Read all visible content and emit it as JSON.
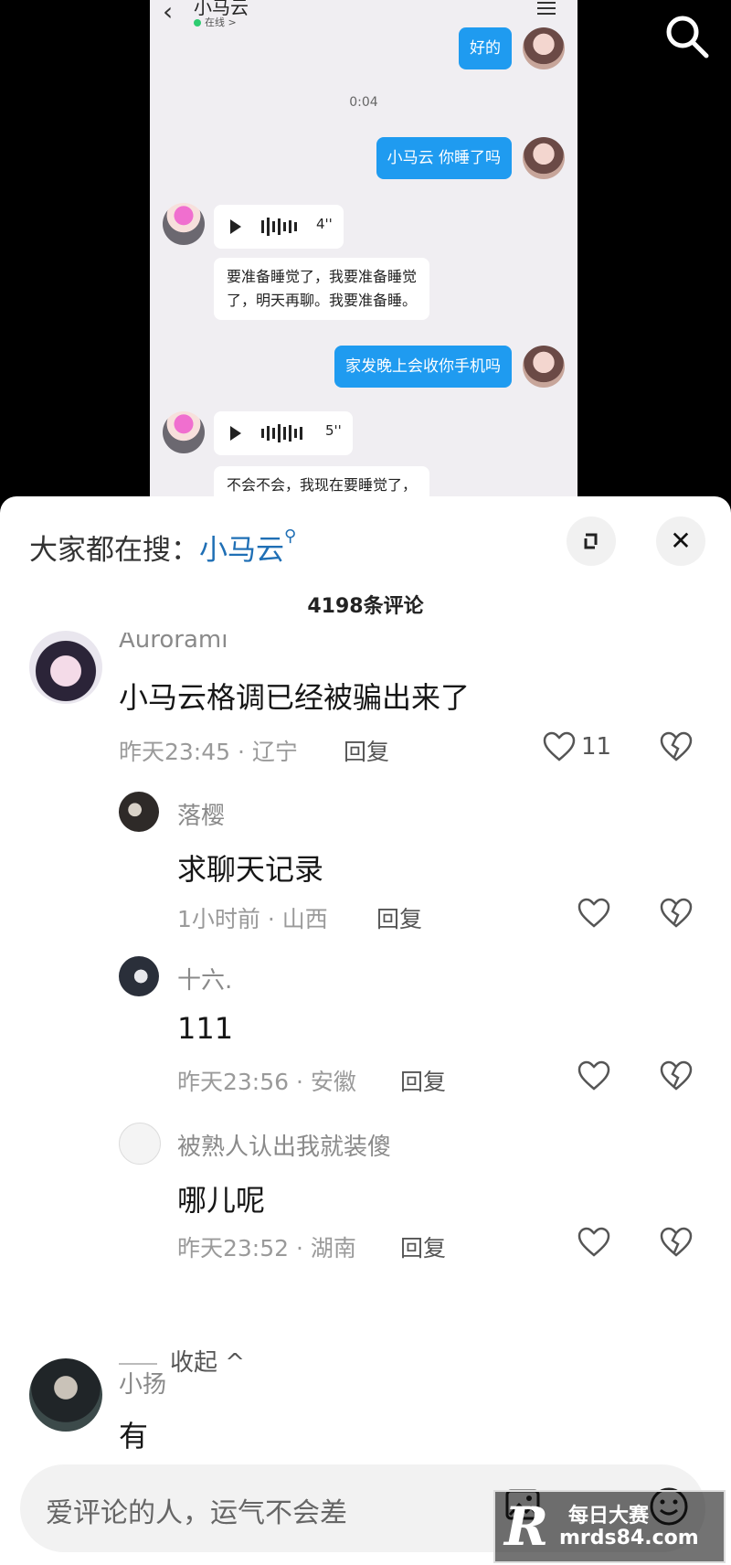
{
  "chat_screenshot": {
    "contact_name": "小马云",
    "status": "在线",
    "status_arrow": ">",
    "messages": {
      "m1": "好的",
      "time": "0:04",
      "m2": "小马云 你睡了吗",
      "voice1_duration": "4''",
      "m3_line1": "要准备睡觉了，我要准备睡觉",
      "m3_line2": "了，明天再聊。我要准备睡。",
      "m4": "家发晚上会收你手机吗",
      "voice2_duration": "5''",
      "m5": "不会不会，我现在要睡觉了，"
    }
  },
  "comments_sheet": {
    "hot_search_prefix": "大家都在搜：",
    "hot_search_term": "小马云",
    "comment_count": "4198条评论",
    "comments": [
      {
        "name": "Aurorami",
        "text": "小马云格调已经被骗出来了",
        "meta": "昨天23:45 · 辽宁",
        "reply": "回复",
        "likes": "11"
      },
      {
        "name": "落樱",
        "text": "求聊天记录",
        "meta": "1小时前 · 山西",
        "reply": "回复"
      },
      {
        "name": "十六.",
        "text": "111",
        "meta": "昨天23:56 · 安徽",
        "reply": "回复"
      },
      {
        "name": "被熟人认出我就装傻",
        "text": "哪儿呢",
        "meta": "昨天23:52 · 湖南",
        "reply": "回复"
      },
      {
        "name": "小扬",
        "text": "有"
      }
    ],
    "collapse_label": "收起 ^",
    "input_placeholder": "爱评论的人，运气不会差"
  },
  "watermark": {
    "line1": "每日大赛",
    "line2": "mrds84.com",
    "logo_letter": "R"
  }
}
